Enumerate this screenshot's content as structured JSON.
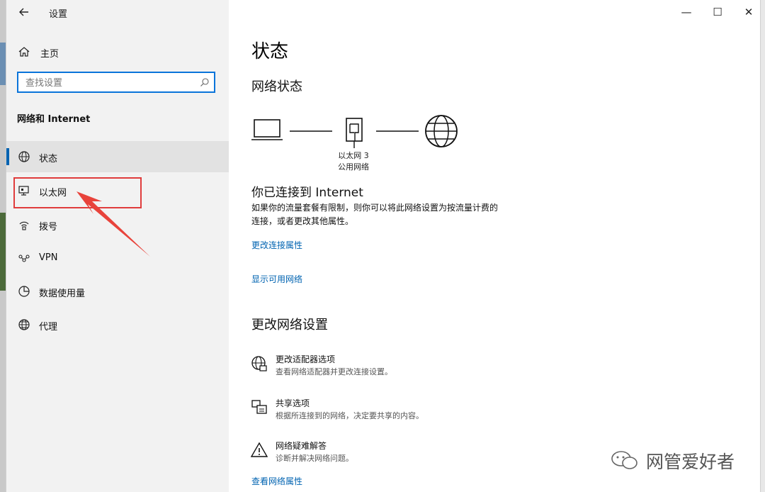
{
  "window": {
    "title": "设置",
    "controls": {
      "minimize": "—",
      "maximize": "☐",
      "close": "✕"
    }
  },
  "sidebar": {
    "home_label": "主页",
    "search_placeholder": "查找设置",
    "section_title": "网络和 Internet",
    "items": [
      {
        "label": "状态",
        "icon": "globe-status-icon",
        "active": true
      },
      {
        "label": "以太网",
        "icon": "ethernet-icon"
      },
      {
        "label": "拨号",
        "icon": "dialup-icon"
      },
      {
        "label": "VPN",
        "icon": "vpn-icon"
      },
      {
        "label": "数据使用量",
        "icon": "data-usage-icon"
      },
      {
        "label": "代理",
        "icon": "proxy-globe-icon"
      }
    ]
  },
  "main": {
    "title": "状态",
    "network_status_heading": "网络状态",
    "diagram": {
      "adapter_name": "以太网 3",
      "network_type": "公用网络"
    },
    "connected_title": "你已连接到 Internet",
    "connected_desc_line1": "如果你的流量套餐有限制，则你可以将此网络设置为按流量计费的",
    "connected_desc_line2": "连接，或者更改其他属性。",
    "link_change_props": "更改连接属性",
    "link_show_networks": "显示可用网络",
    "change_settings_heading": "更改网络设置",
    "settings": [
      {
        "title": "更改适配器选项",
        "subtitle": "查看网络适配器并更改连接设置。",
        "icon": "adapter-icon"
      },
      {
        "title": "共享选项",
        "subtitle": "根据所连接到的网络，决定要共享的内容。",
        "icon": "sharing-icon"
      },
      {
        "title": "网络疑难解答",
        "subtitle": "诊断并解决网络问题。",
        "icon": "warning-icon"
      }
    ],
    "link_view_properties": "查看网络属性"
  },
  "watermark": "网管爱好者",
  "colors": {
    "accent": "#0063b1",
    "highlight": "#e03c3c",
    "search_border": "#0a74da"
  }
}
